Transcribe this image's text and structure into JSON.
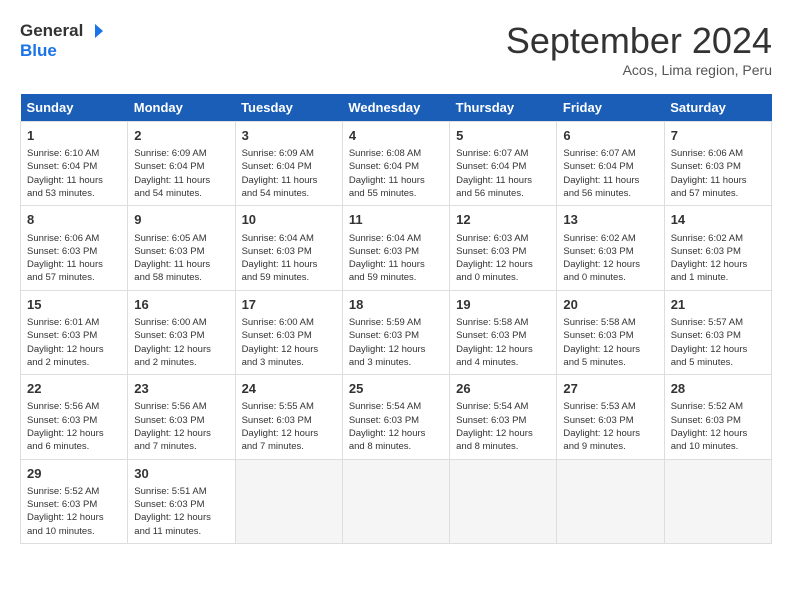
{
  "logo": {
    "line1": "General",
    "line2": "Blue"
  },
  "title": "September 2024",
  "subtitle": "Acos, Lima region, Peru",
  "days_header": [
    "Sunday",
    "Monday",
    "Tuesday",
    "Wednesday",
    "Thursday",
    "Friday",
    "Saturday"
  ],
  "weeks": [
    [
      {
        "num": "1",
        "info": "Sunrise: 6:10 AM\nSunset: 6:04 PM\nDaylight: 11 hours\nand 53 minutes."
      },
      {
        "num": "2",
        "info": "Sunrise: 6:09 AM\nSunset: 6:04 PM\nDaylight: 11 hours\nand 54 minutes."
      },
      {
        "num": "3",
        "info": "Sunrise: 6:09 AM\nSunset: 6:04 PM\nDaylight: 11 hours\nand 54 minutes."
      },
      {
        "num": "4",
        "info": "Sunrise: 6:08 AM\nSunset: 6:04 PM\nDaylight: 11 hours\nand 55 minutes."
      },
      {
        "num": "5",
        "info": "Sunrise: 6:07 AM\nSunset: 6:04 PM\nDaylight: 11 hours\nand 56 minutes."
      },
      {
        "num": "6",
        "info": "Sunrise: 6:07 AM\nSunset: 6:04 PM\nDaylight: 11 hours\nand 56 minutes."
      },
      {
        "num": "7",
        "info": "Sunrise: 6:06 AM\nSunset: 6:03 PM\nDaylight: 11 hours\nand 57 minutes."
      }
    ],
    [
      {
        "num": "8",
        "info": "Sunrise: 6:06 AM\nSunset: 6:03 PM\nDaylight: 11 hours\nand 57 minutes."
      },
      {
        "num": "9",
        "info": "Sunrise: 6:05 AM\nSunset: 6:03 PM\nDaylight: 11 hours\nand 58 minutes."
      },
      {
        "num": "10",
        "info": "Sunrise: 6:04 AM\nSunset: 6:03 PM\nDaylight: 11 hours\nand 59 minutes."
      },
      {
        "num": "11",
        "info": "Sunrise: 6:04 AM\nSunset: 6:03 PM\nDaylight: 11 hours\nand 59 minutes."
      },
      {
        "num": "12",
        "info": "Sunrise: 6:03 AM\nSunset: 6:03 PM\nDaylight: 12 hours\nand 0 minutes."
      },
      {
        "num": "13",
        "info": "Sunrise: 6:02 AM\nSunset: 6:03 PM\nDaylight: 12 hours\nand 0 minutes."
      },
      {
        "num": "14",
        "info": "Sunrise: 6:02 AM\nSunset: 6:03 PM\nDaylight: 12 hours\nand 1 minute."
      }
    ],
    [
      {
        "num": "15",
        "info": "Sunrise: 6:01 AM\nSunset: 6:03 PM\nDaylight: 12 hours\nand 2 minutes."
      },
      {
        "num": "16",
        "info": "Sunrise: 6:00 AM\nSunset: 6:03 PM\nDaylight: 12 hours\nand 2 minutes."
      },
      {
        "num": "17",
        "info": "Sunrise: 6:00 AM\nSunset: 6:03 PM\nDaylight: 12 hours\nand 3 minutes."
      },
      {
        "num": "18",
        "info": "Sunrise: 5:59 AM\nSunset: 6:03 PM\nDaylight: 12 hours\nand 3 minutes."
      },
      {
        "num": "19",
        "info": "Sunrise: 5:58 AM\nSunset: 6:03 PM\nDaylight: 12 hours\nand 4 minutes."
      },
      {
        "num": "20",
        "info": "Sunrise: 5:58 AM\nSunset: 6:03 PM\nDaylight: 12 hours\nand 5 minutes."
      },
      {
        "num": "21",
        "info": "Sunrise: 5:57 AM\nSunset: 6:03 PM\nDaylight: 12 hours\nand 5 minutes."
      }
    ],
    [
      {
        "num": "22",
        "info": "Sunrise: 5:56 AM\nSunset: 6:03 PM\nDaylight: 12 hours\nand 6 minutes."
      },
      {
        "num": "23",
        "info": "Sunrise: 5:56 AM\nSunset: 6:03 PM\nDaylight: 12 hours\nand 7 minutes."
      },
      {
        "num": "24",
        "info": "Sunrise: 5:55 AM\nSunset: 6:03 PM\nDaylight: 12 hours\nand 7 minutes."
      },
      {
        "num": "25",
        "info": "Sunrise: 5:54 AM\nSunset: 6:03 PM\nDaylight: 12 hours\nand 8 minutes."
      },
      {
        "num": "26",
        "info": "Sunrise: 5:54 AM\nSunset: 6:03 PM\nDaylight: 12 hours\nand 8 minutes."
      },
      {
        "num": "27",
        "info": "Sunrise: 5:53 AM\nSunset: 6:03 PM\nDaylight: 12 hours\nand 9 minutes."
      },
      {
        "num": "28",
        "info": "Sunrise: 5:52 AM\nSunset: 6:03 PM\nDaylight: 12 hours\nand 10 minutes."
      }
    ],
    [
      {
        "num": "29",
        "info": "Sunrise: 5:52 AM\nSunset: 6:03 PM\nDaylight: 12 hours\nand 10 minutes."
      },
      {
        "num": "30",
        "info": "Sunrise: 5:51 AM\nSunset: 6:03 PM\nDaylight: 12 hours\nand 11 minutes."
      },
      null,
      null,
      null,
      null,
      null
    ]
  ]
}
